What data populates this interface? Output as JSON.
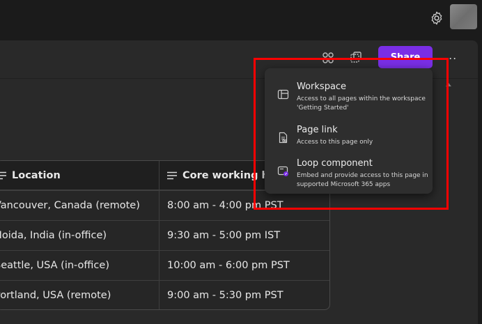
{
  "toolbar": {
    "share_label": "Share",
    "more_label": "..."
  },
  "share_menu": {
    "options": [
      {
        "title": "Workspace",
        "description": "Access to all pages within the workspace 'Getting Started'",
        "icon": "workspace-icon"
      },
      {
        "title": "Page link",
        "description": "Access to this page only",
        "icon": "page-link-icon"
      },
      {
        "title": "Loop component",
        "description": "Embed and provide access to this page in supported Microsoft 365 apps",
        "icon": "loop-component-icon"
      }
    ]
  },
  "table": {
    "headers": [
      "Location",
      "Core working h"
    ],
    "rows": [
      [
        "Vancouver, Canada (remote)",
        "8:00 am - 4:00 pm PST"
      ],
      [
        "Noida, India (in-office)",
        "9:30 am - 5:00 pm IST"
      ],
      [
        "Seattle, USA (in-office)",
        "10:00 am - 6:00 pm PST"
      ],
      [
        "Portland, USA (remote)",
        "9:00 am - 5:30 pm PST"
      ]
    ]
  },
  "colors": {
    "accent": "#7a2ee6",
    "highlight": "#ff0000"
  }
}
